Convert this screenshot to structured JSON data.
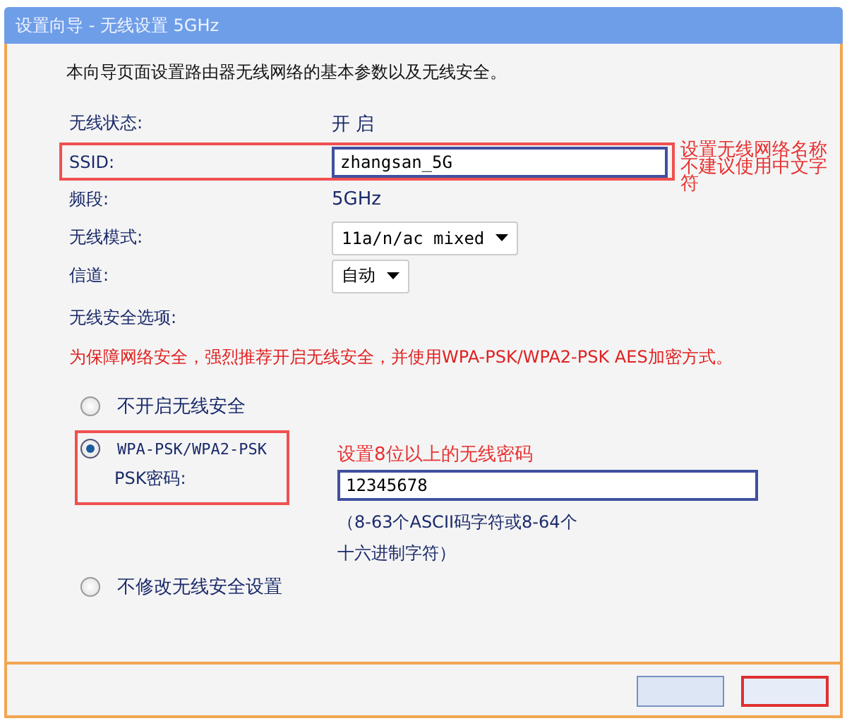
{
  "window": {
    "title": "设置向导 - 无线设置 5GHz"
  },
  "intro": "本向导页面设置路由器无线网络的基本参数以及无线安全。",
  "fields": [
    {
      "kind": "text",
      "label": "无线状态:",
      "value": "开 启"
    },
    {
      "kind": "input",
      "label": "SSID:",
      "value": "zhangsan_5G",
      "highlighted": true,
      "note": "设置无线网络名称不建议使用中文字符"
    },
    {
      "kind": "text",
      "label": "频段:",
      "value": "5GHz"
    },
    {
      "kind": "select",
      "label": "无线模式:",
      "value": "11a/n/ac mixed"
    },
    {
      "kind": "select",
      "label": "信道:",
      "value": "自动"
    }
  ],
  "security": {
    "label": "无线安全选项:",
    "warning": "为保障网络安全，强烈推荐开启无线安全，并使用WPA-PSK/WPA2-PSK AES加密方式。",
    "options": [
      {
        "label": "不开启无线安全",
        "selected": false
      },
      {
        "label": "WPA-PSK/WPA2-PSK",
        "selected": true,
        "highlighted": true,
        "password_label": "PSK密码:",
        "password": "12345678",
        "note": "设置8位以上的无线密码",
        "hint": "（8-63个ASCII码字符或8-64个十六进制字符）"
      },
      {
        "label": "不修改无线安全设置",
        "selected": false
      }
    ]
  },
  "buttons": [
    {
      "kind": "back",
      "highlighted": false
    },
    {
      "kind": "next",
      "highlighted": true
    }
  ]
}
